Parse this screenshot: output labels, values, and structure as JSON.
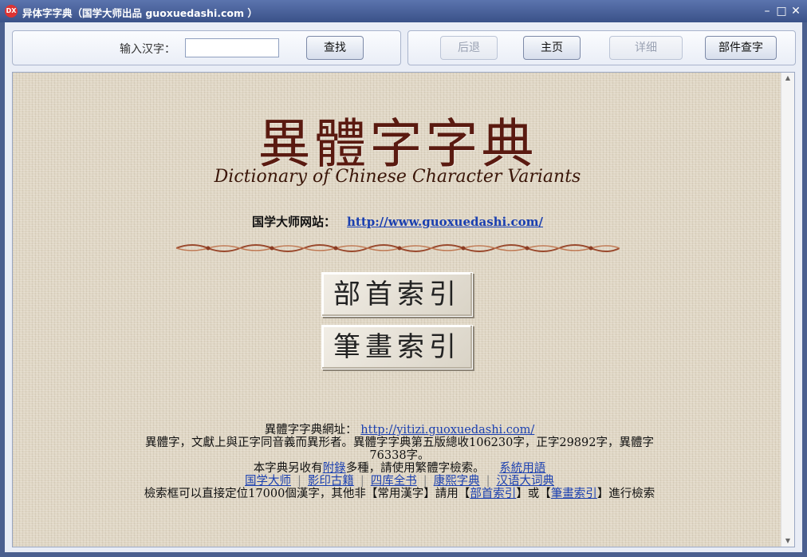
{
  "window": {
    "title": "异体字字典（国学大师出品 guoxuedashi.com ）",
    "icon_text": "DX"
  },
  "toolbar": {
    "input_label": "输入汉字：",
    "input_value": "",
    "search_label": "查找",
    "back_label": "后退",
    "home_label": "主页",
    "detail_label": "详细",
    "component_label": "部件查字"
  },
  "content": {
    "title_cn": "異體字字典",
    "title_en": "Dictionary of Chinese Character Variants",
    "site_label": "国学大师网站：",
    "site_url": "http://www.guoxuedashi.com/",
    "radical_index": "部首索引",
    "stroke_index": "筆畫索引",
    "footer": {
      "url_label": "異體字字典網址：",
      "url": "http://yitizi.guoxuedashi.com/",
      "desc1": "異體字，文獻上與正字同音義而異形者。異體字字典第五版總收106230字，正字29892字，異體字76338字。",
      "desc2_pre": "本字典另收有",
      "appendix_link": "附錄",
      "desc2_post": "多種，請使用繁體字檢索。",
      "system_terms": "系統用語",
      "links": [
        "国学大师",
        "影印古籍",
        "四库全书",
        "康熙字典",
        "汉语大词典"
      ],
      "search_pre": "檢索框可以直接定位17000個漢字，其他非【常用漢字】請用【",
      "radical_link": "部首索引",
      "search_mid": "】或【",
      "stroke_link": "筆畫索引",
      "search_post": "】進行檢索"
    }
  },
  "colors": {
    "title_bar": "#3a5188",
    "title_cn": "#5a1a10",
    "link": "#1a3fb0",
    "paper_bg": "#dfd6c4"
  }
}
